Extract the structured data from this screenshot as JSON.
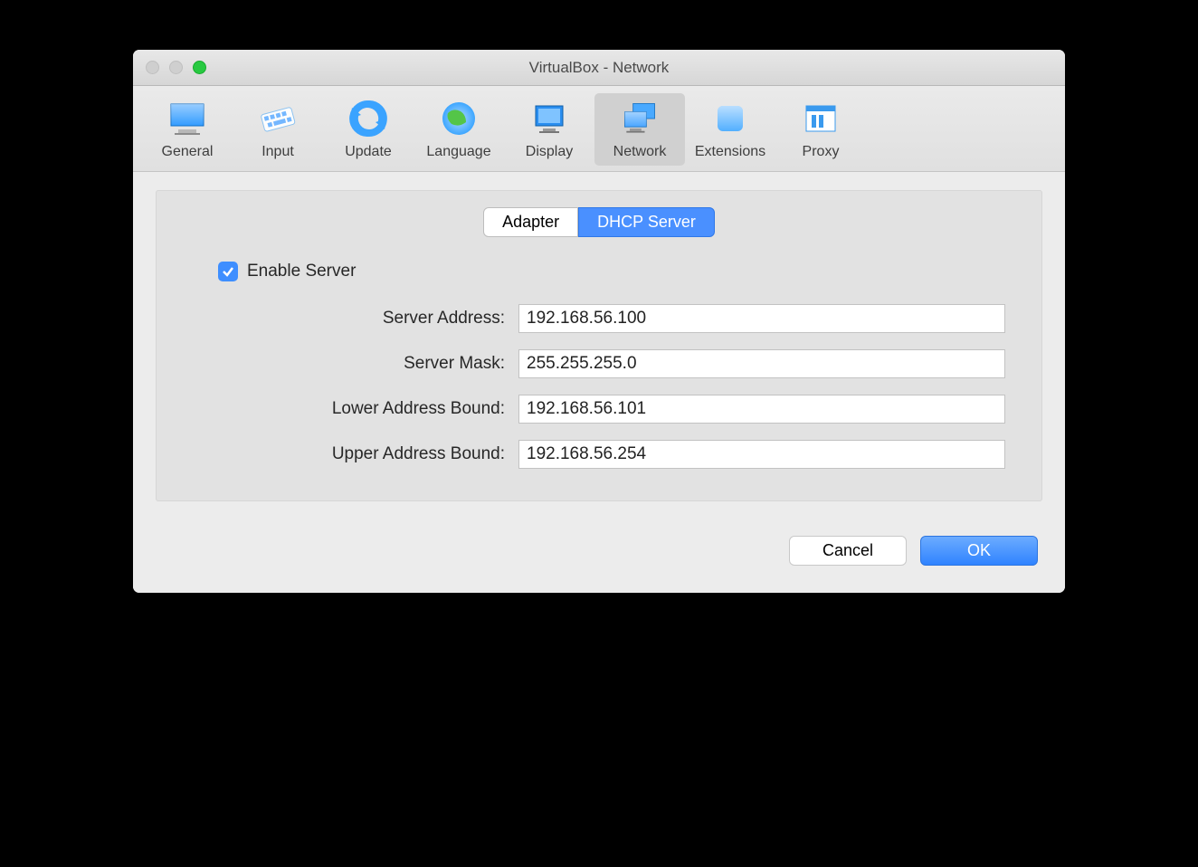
{
  "window": {
    "title": "VirtualBox - Network"
  },
  "toolbar": {
    "items": [
      {
        "label": "General",
        "icon": "monitor"
      },
      {
        "label": "Input",
        "icon": "keyboard"
      },
      {
        "label": "Update",
        "icon": "refresh"
      },
      {
        "label": "Language",
        "icon": "globe"
      },
      {
        "label": "Display",
        "icon": "monitor-small"
      },
      {
        "label": "Network",
        "icon": "network",
        "active": true
      },
      {
        "label": "Extensions",
        "icon": "box"
      },
      {
        "label": "Proxy",
        "icon": "columns"
      }
    ]
  },
  "tabs": {
    "adapter": "Adapter",
    "dhcp": "DHCP Server",
    "active": "dhcp"
  },
  "form": {
    "enable_label": "Enable Server",
    "enable_checked": true,
    "server_address": {
      "label": "Server Address:",
      "value": "192.168.56.100"
    },
    "server_mask": {
      "label": "Server Mask:",
      "value": "255.255.255.0"
    },
    "lower_bound": {
      "label": "Lower Address Bound:",
      "value": "192.168.56.101"
    },
    "upper_bound": {
      "label": "Upper Address Bound:",
      "value": "192.168.56.254"
    }
  },
  "footer": {
    "cancel": "Cancel",
    "ok": "OK"
  }
}
